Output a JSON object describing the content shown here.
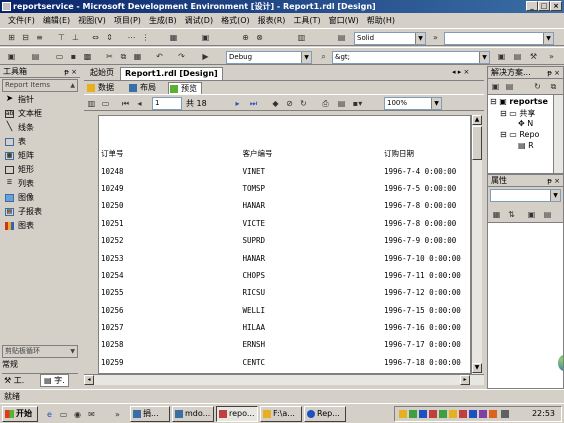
{
  "window": {
    "title": "reportservice - Microsoft Development Environment [设计] - Report1.rdl [Design]",
    "controls": [
      "_",
      "□",
      "×"
    ]
  },
  "menu": [
    "文件(F)",
    "编辑(E)",
    "视图(V)",
    "项目(P)",
    "生成(B)",
    "调试(D)",
    "格式(O)",
    "报表(R)",
    "工具(T)",
    "窗口(W)",
    "帮助(H)"
  ],
  "toolbar": {
    "border_style": "Solid",
    "config": "Debug",
    "find_value": "&gt;"
  },
  "toolbox": {
    "title": "工具箱",
    "group": "Report Items",
    "items": [
      {
        "label": "指针",
        "icon": "pointer-icon"
      },
      {
        "label": "文本框",
        "icon": "textbox-icon"
      },
      {
        "label": "线条",
        "icon": "line-icon"
      },
      {
        "label": "表",
        "icon": "table-icon"
      },
      {
        "label": "矩阵",
        "icon": "matrix-icon"
      },
      {
        "label": "矩形",
        "icon": "rectangle-icon"
      },
      {
        "label": "列表",
        "icon": "list-icon"
      },
      {
        "label": "图像",
        "icon": "image-icon"
      },
      {
        "label": "子报表",
        "icon": "subreport-icon"
      },
      {
        "label": "图表",
        "icon": "chart-icon"
      }
    ],
    "footer": [
      "剪贴板循环",
      "常规"
    ],
    "bottom_tabs": [
      "工.",
      "字."
    ]
  },
  "doc": {
    "tabs": [
      "起始页",
      "Report1.rdl [Design]"
    ],
    "subtabs": [
      "数据",
      "布局",
      "预览"
    ],
    "page_input": "1",
    "page_total": "共 18",
    "zoom": "100%"
  },
  "report": {
    "headers": [
      "订单号",
      "客户编号",
      "订购日期"
    ],
    "rows": [
      [
        "10248",
        "VINET",
        "1996-7-4 0:00:00"
      ],
      [
        "10249",
        "TOMSP",
        "1996-7-5 0:00:00"
      ],
      [
        "10250",
        "HANAR",
        "1996-7-8 0:00:00"
      ],
      [
        "10251",
        "VICTE",
        "1996-7-8 0:00:00"
      ],
      [
        "10252",
        "SUPRD",
        "1996-7-9 0:00:00"
      ],
      [
        "10253",
        "HANAR",
        "1996-7-10 0:00:00"
      ],
      [
        "10254",
        "CHOPS",
        "1996-7-11 0:00:00"
      ],
      [
        "10255",
        "RICSU",
        "1996-7-12 0:00:00"
      ],
      [
        "10256",
        "WELLI",
        "1996-7-15 0:00:00"
      ],
      [
        "10257",
        "HILAA",
        "1996-7-16 0:00:00"
      ],
      [
        "10258",
        "ERNSH",
        "1996-7-17 0:00:00"
      ],
      [
        "10259",
        "CENTC",
        "1996-7-18 0:00:00"
      ]
    ]
  },
  "solution": {
    "title": "解决方案...",
    "nodes": [
      "reportse",
      "共享",
      "N",
      "Repo",
      "R"
    ]
  },
  "properties": {
    "title": "属性"
  },
  "status": "就绪",
  "taskbar": {
    "start": "开始",
    "tasks": [
      "捐...",
      "mdo...",
      "repo...",
      "F:\\a...",
      "Rep..."
    ],
    "clock": "22:53"
  }
}
